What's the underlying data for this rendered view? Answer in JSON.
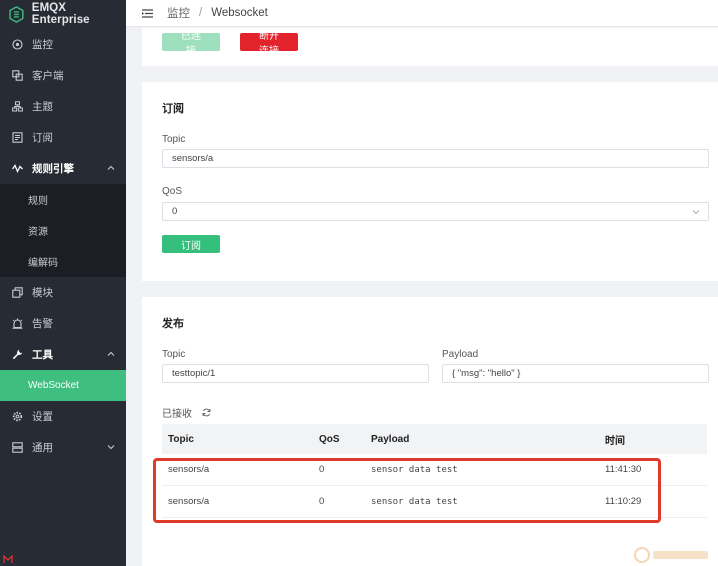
{
  "app": {
    "brand": "EMQX Enterprise"
  },
  "breadcrumb": {
    "root": "监控",
    "separator": "/",
    "current": "Websocket"
  },
  "sidebar": {
    "items": [
      {
        "label": "监控",
        "icon": "monitor-icon"
      },
      {
        "label": "客户端",
        "icon": "clients-icon"
      },
      {
        "label": "主题",
        "icon": "topics-icon"
      },
      {
        "label": "订阅",
        "icon": "subscriptions-icon"
      },
      {
        "label": "规则引擎",
        "icon": "rule-engine-icon"
      },
      {
        "label": "规则"
      },
      {
        "label": "资源"
      },
      {
        "label": "编解码"
      },
      {
        "label": "模块",
        "icon": "modules-icon"
      },
      {
        "label": "告警",
        "icon": "alarm-icon"
      },
      {
        "label": "工具",
        "icon": "tools-icon"
      },
      {
        "label": "WebSocket"
      },
      {
        "label": "设置",
        "icon": "settings-icon"
      },
      {
        "label": "通用",
        "icon": "general-icon"
      }
    ]
  },
  "connection": {
    "connected_label": "已连接",
    "disconnect_label": "断开连接"
  },
  "subscribe": {
    "title": "订阅",
    "topic_label": "Topic",
    "topic_value": "sensors/a",
    "qos_label": "QoS",
    "qos_value": "0",
    "button_label": "订阅"
  },
  "publish": {
    "title": "发布",
    "topic_label": "Topic",
    "topic_value": "testtopic/1",
    "payload_label": "Payload",
    "payload_value": "{ \"msg\": \"hello\" }"
  },
  "received": {
    "label": "已接收",
    "columns": [
      "Topic",
      "QoS",
      "Payload",
      "时间"
    ],
    "rows": [
      {
        "topic": "sensors/a",
        "qos": "0",
        "payload": "sensor data test",
        "time": "11:41:30"
      },
      {
        "topic": "sensors/a",
        "qos": "0",
        "payload": "sensor data test",
        "time": "11:10:29"
      }
    ]
  },
  "colors": {
    "sidebar_bg": "#272b33",
    "accent": "#34bf7c",
    "danger": "#e2232c",
    "highlight": "#e03a2b"
  }
}
